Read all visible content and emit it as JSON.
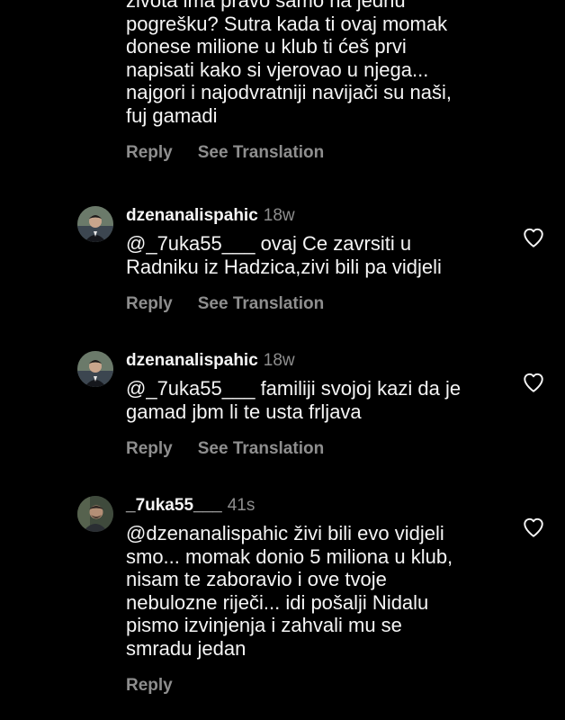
{
  "top_comment": {
    "text": "života ima pravo samo na jednu\npogrešku? Sutra kada ti ovaj momak\ndonese milione u klub ti ćeš prvi\nnapisati kako si vjerovao u njega...\nnajgori i najodvratniji navijači su naši,\nfuj gamadi",
    "reply_label": "Reply",
    "translation_label": "See Translation"
  },
  "comments": [
    {
      "username": "dzenanalispahic",
      "time": "18w",
      "text": "@_7uka55___ ovaj Ce zavrsiti u\nRadniku iz Hadzica,zivi bili pa vidjeli",
      "reply_label": "Reply",
      "translation_label": "See Translation",
      "like_icon": "heart-outline-icon"
    },
    {
      "username": "dzenanalispahic",
      "time": "18w",
      "text": "@_7uka55___ familiji svojoj  kazi da je\ngamad jbm li te usta frljava",
      "reply_label": "Reply",
      "translation_label": "See Translation",
      "like_icon": "heart-outline-icon"
    },
    {
      "username": "_7uka55___",
      "time": "41s",
      "text": "@dzenanalispahic živi bili evo vidjeli\nsmo... momak donio 5 miliona u klub,\nnisam te zaboravio i ove tvoje\nnebulozne riječi... idi pošalji Nidalu\npismo izvinjenja i zahvali mu se\nsmradu jedan",
      "reply_label": "Reply",
      "like_icon": "heart-outline-icon"
    }
  ],
  "colors": {
    "background": "#000000",
    "text": "#f5f5f5",
    "muted": "#8e8e8e"
  }
}
